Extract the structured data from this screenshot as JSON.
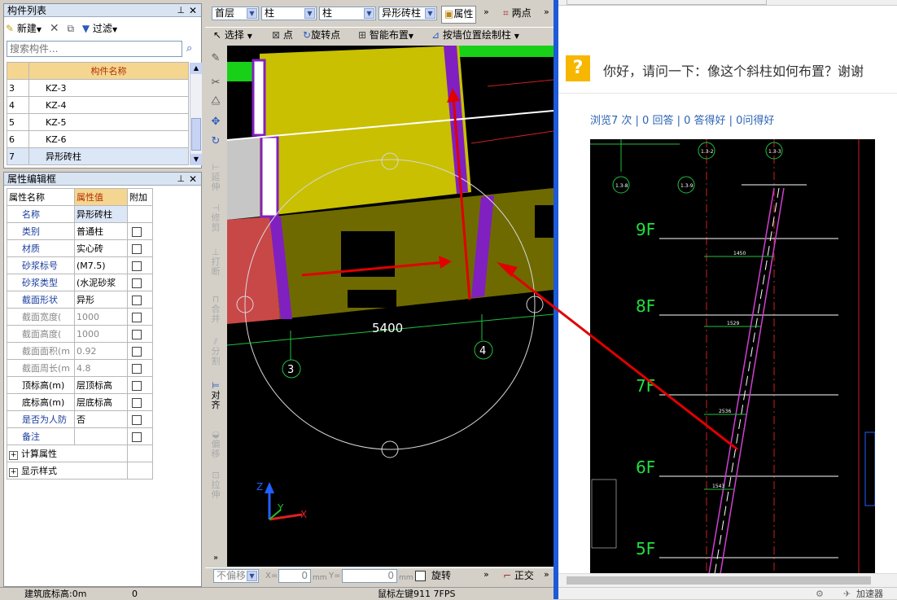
{
  "component_list": {
    "title": "构件列表",
    "toolbar": {
      "new": "新建",
      "filter": "过滤"
    },
    "search_placeholder": "搜索构件...",
    "column_header": "构件名称",
    "rows": [
      {
        "num": "3",
        "name": "KZ-3"
      },
      {
        "num": "4",
        "name": "KZ-4"
      },
      {
        "num": "5",
        "name": "KZ-5"
      },
      {
        "num": "6",
        "name": "KZ-6"
      },
      {
        "num": "7",
        "name": "异形砖柱"
      }
    ]
  },
  "property_editor": {
    "title": "属性编辑框",
    "headers": {
      "name": "属性名称",
      "value": "属性值",
      "extra": "附加"
    },
    "rows": [
      {
        "name": "名称",
        "value": "异形砖柱"
      },
      {
        "name": "类别",
        "value": "普通柱"
      },
      {
        "name": "材质",
        "value": "实心砖"
      },
      {
        "name": "砂浆标号",
        "value": "(M7.5)"
      },
      {
        "name": "砂浆类型",
        "value": "(水泥砂浆"
      },
      {
        "name": "截面形状",
        "value": "异形"
      },
      {
        "name": "截面宽度(",
        "value": "1000"
      },
      {
        "name": "截面高度(",
        "value": "1000"
      },
      {
        "name": "截面面积(m",
        "value": "0.92"
      },
      {
        "name": "截面周长(m",
        "value": "4.8"
      },
      {
        "name": "顶标高(m)",
        "value": "层顶标高"
      },
      {
        "name": "底标高(m)",
        "value": "层底标高"
      },
      {
        "name": "是否为人防",
        "value": "否"
      },
      {
        "name": "备注",
        "value": ""
      }
    ],
    "groups": [
      "计算属性",
      "显示样式"
    ]
  },
  "top_toolbar": {
    "floor": "首层",
    "type1": "柱",
    "type2": "柱",
    "component": "异形砖柱",
    "property_button": "属性",
    "two_point": "两点"
  },
  "second_toolbar": {
    "select": "选择",
    "point": "点",
    "rotate_point": "旋转点",
    "smart_layout": "智能布置",
    "draw_by_wall": "按墙位置绘制柱"
  },
  "side_tools": [
    "延伸",
    "修剪",
    "打断",
    "合并",
    "分割",
    "对齐",
    "偏移",
    "拉伸"
  ],
  "canvas": {
    "dimension": "5400",
    "axis_labels": [
      "3",
      "4"
    ],
    "axes": {
      "z": "Z",
      "y": "Y",
      "x": "X"
    }
  },
  "status_bar": {
    "offset": "不偏移",
    "x_label": "X=",
    "x_value": "0",
    "y_label": "Y=",
    "y_value": "0",
    "unit": "mm",
    "rotate": "旋转",
    "ortho": "正交",
    "bottom_left": "建筑底标高:0m",
    "bottom_mid": "0",
    "bottom_right": "鼠标左键911 7FPS"
  },
  "qa": {
    "question": "你好，请问一下：像这个斜柱如何布置？谢谢",
    "stats": "浏览7 次 | 0 回答 | 0 答得好 | 0问得好",
    "floor_labels": [
      "9F",
      "8F",
      "7F",
      "6F",
      "5F"
    ],
    "dims": [
      "1450",
      "1529",
      "2536",
      "1543"
    ],
    "grid_tags": [
      "1.3-2",
      "1.3-3",
      "1.3-8",
      "1.3-9"
    ],
    "footer_accelerator": "加速器"
  },
  "colors": {
    "toolbar_bg": "#d4d0c8",
    "panel_title": "#d9e4f2",
    "selected_row": "#dbe7f7",
    "header_row": "#f5d690",
    "cad_bg": "#000000",
    "arrow": "#e00000"
  }
}
